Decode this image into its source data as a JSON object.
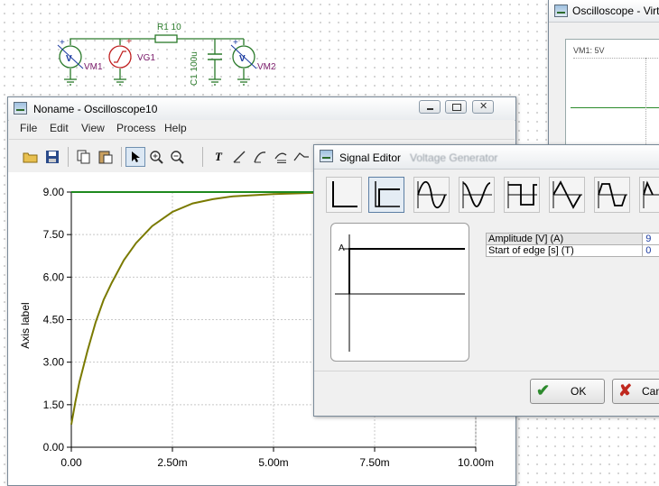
{
  "schematic": {
    "resistor_label": "R1 10",
    "capacitor_label": "C1 100u",
    "source_label": "VG1",
    "vm1_label": "VM1",
    "vm2_label": "VM2",
    "meter_symbol": "V",
    "plus": "+"
  },
  "scope_window": {
    "title": "Oscilloscope - Virt",
    "channel_label": "VM1: 5V"
  },
  "main_window": {
    "title": "Noname - Oscilloscope10",
    "menu": [
      "File",
      "Edit",
      "View",
      "Process",
      "Help"
    ],
    "toolbar_icons": [
      "open-folder-icon",
      "save-icon",
      "copy-icon",
      "paste-icon",
      "pointer-icon",
      "zoom-in-icon",
      "zoom-reset-icon",
      "text-icon",
      "line-tool-icon",
      "curve-tool-icon",
      "legend-icon",
      "signal-icon"
    ]
  },
  "chart_data": {
    "type": "line",
    "ylabel": "Axis label",
    "xlabel": "",
    "title": "",
    "x_ticks": [
      "0.00",
      "2.50m",
      "5.00m",
      "7.50m",
      "10.00m"
    ],
    "y_ticks": [
      "0.00",
      "1.50",
      "3.00",
      "4.50",
      "6.00",
      "7.50",
      "9.00"
    ],
    "xlim": [
      0,
      0.01
    ],
    "ylim": [
      0,
      9.6
    ],
    "grid": true,
    "series": [
      {
        "name": "",
        "color": "#7a7a00",
        "x": [
          0,
          0.0001,
          0.0002,
          0.0004,
          0.0006,
          0.0008,
          0.001,
          0.0013,
          0.0016,
          0.002,
          0.0025,
          0.003,
          0.0035,
          0.004,
          0.005,
          0.006,
          0.007
        ],
        "y": [
          0.8,
          1.6,
          2.3,
          3.4,
          4.4,
          5.2,
          5.8,
          6.6,
          7.2,
          7.8,
          8.3,
          8.6,
          8.75,
          8.85,
          8.93,
          8.97,
          9.0
        ]
      },
      {
        "name": "",
        "color": "#1e8a1e",
        "x": [
          0,
          0.01
        ],
        "y": [
          9,
          9
        ]
      }
    ]
  },
  "signal_editor": {
    "title": "Signal Editor",
    "subtitle": "Voltage Generator",
    "shape_buttons": [
      "dc-shape",
      "step-shape",
      "sine-shape",
      "cosine-shape",
      "square-shape",
      "triangle-shape",
      "trapezoid-shape",
      "pulse-shape"
    ],
    "preview_label": "A",
    "params": [
      {
        "name": "Amplitude [V] (A)",
        "value": "9"
      },
      {
        "name": "Start of edge [s] (T)",
        "value": "0"
      }
    ],
    "ok_label": "OK",
    "cancel_label": "Can"
  },
  "colors": {
    "ok_check": "#2d8a2d",
    "cancel_x": "#c0281e",
    "trace_green": "#1e8a1e",
    "trace_olive": "#7a7a00"
  }
}
